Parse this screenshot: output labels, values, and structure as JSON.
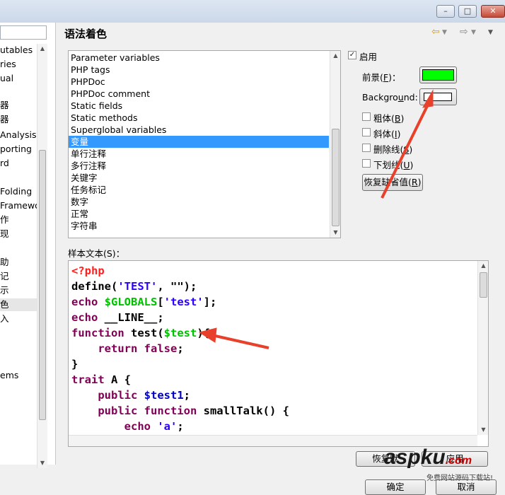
{
  "header": {
    "title": "语法着色",
    "nav_back_icon": "arrow-left-icon",
    "nav_forward_icon": "arrow-right-icon",
    "menu_icon": "chevron-down-icon"
  },
  "window": {
    "minimize": "–",
    "maximize": "□",
    "close": "✕"
  },
  "nav": {
    "items": [
      "utables",
      "ries",
      "ual",
      "器",
      "器",
      "Analysis",
      "porting",
      "rd",
      "Folding",
      "Framewo",
      "作",
      "现",
      "助",
      "记",
      "示",
      "色",
      "入",
      "ems"
    ]
  },
  "elements": {
    "items": [
      "Parameter variables",
      "PHP tags",
      "PHPDoc",
      "PHPDoc comment",
      "Static fields",
      "Static methods",
      "Superglobal variables",
      "变量",
      "单行注释",
      "多行注释",
      "关键字",
      "任务标记",
      "数字",
      "正常",
      "字符串"
    ],
    "selected": "变量"
  },
  "options": {
    "enable_label": "启用",
    "enable_checked": true,
    "foreground_label": "前景(",
    "foreground_key": "F",
    "foreground_suffix": ")：",
    "foreground_color": "#00ff00",
    "background_label": "Backgro",
    "background_key": "u",
    "background_suffix": "nd:",
    "background_color": "#ffffff",
    "bold_label": "粗体(",
    "bold_key": "B",
    "italic_label": "斜体(",
    "italic_key": "I",
    "strike_label": "删除线(",
    "strike_key": "S",
    "underline_label": "下划线(",
    "underline_key": "U",
    "close_paren": ")",
    "restore_label": "恢复缺省值(",
    "restore_key": "R"
  },
  "sample": {
    "label": "样本文本(S)：",
    "lines": [
      [
        {
          "t": "<?php",
          "c": "tag"
        }
      ],
      [
        {
          "t": "define(",
          "c": "plain"
        },
        {
          "t": "'TEST'",
          "c": "str"
        },
        {
          "t": ", \"\");",
          "c": "plain"
        }
      ],
      [
        {
          "t": "echo ",
          "c": "kw"
        },
        {
          "t": "$GLOBALS",
          "c": "gvar"
        },
        {
          "t": "[",
          "c": "plain"
        },
        {
          "t": "'test'",
          "c": "str"
        },
        {
          "t": "];",
          "c": "plain"
        }
      ],
      [
        {
          "t": "echo ",
          "c": "kw"
        },
        {
          "t": "__LINE__;",
          "c": "plain"
        }
      ],
      [
        {
          "t": "function ",
          "c": "kw"
        },
        {
          "t": "test(",
          "c": "plain"
        },
        {
          "t": "$test",
          "c": "sel-var"
        },
        {
          "t": "){",
          "c": "plain"
        }
      ],
      [
        {
          "t": "    return false",
          "c": "kw"
        },
        {
          "t": ";",
          "c": "plain"
        }
      ],
      [
        {
          "t": "}",
          "c": "plain"
        }
      ],
      [
        {
          "t": "trait ",
          "c": "kw"
        },
        {
          "t": "A {",
          "c": "plain"
        }
      ],
      [
        {
          "t": "    public ",
          "c": "kw"
        },
        {
          "t": "$test1",
          "c": "var"
        },
        {
          "t": ";",
          "c": "plain"
        }
      ],
      [
        {
          "t": "    public function ",
          "c": "kw"
        },
        {
          "t": "smallTalk() {",
          "c": "plain"
        }
      ],
      [
        {
          "t": "        echo ",
          "c": "kw"
        },
        {
          "t": "'a'",
          "c": "str"
        },
        {
          "t": ";",
          "c": "plain"
        }
      ]
    ]
  },
  "footer": {
    "restore_defaults": "恢复默",
    "apply": "应用",
    "ok": "确定",
    "cancel": "取消"
  },
  "watermark": {
    "brand": "aspku",
    "brand_suffix": ".com",
    "tagline": "免费网站源码下载站!"
  },
  "colors": {
    "selection": "#3399ff",
    "keyword": "#7f0055",
    "string": "#2a00ff",
    "variable": "#0000c0",
    "highlight_variable": "#00c000",
    "php_tag": "#ff2020",
    "annotation_arrow": "#e8402a"
  }
}
